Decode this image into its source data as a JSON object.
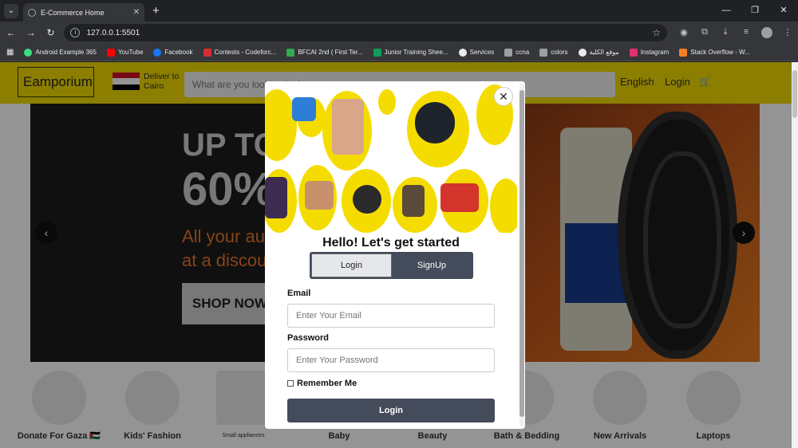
{
  "browser": {
    "tab_title": "E-Commerce Home",
    "url": "127.0.0.1:5501",
    "bookmarks": [
      {
        "label": "Android Example 365",
        "color": "#3ddc84"
      },
      {
        "label": "YouTube",
        "color": "#ff0000"
      },
      {
        "label": "Facebook",
        "color": "#1877f2"
      },
      {
        "label": "Contests - Codeforc...",
        "color": "#d32f2f"
      },
      {
        "label": "BFCAI 2nd ( First Ter...",
        "color": "#34a853"
      },
      {
        "label": "Junior Training Shee...",
        "color": "#0f9d58"
      },
      {
        "label": "Services",
        "color": "#e8eaed"
      },
      {
        "label": "ccna",
        "color": "#9aa0a6"
      },
      {
        "label": "colors",
        "color": "#9aa0a6"
      },
      {
        "label": "موقع الكلية",
        "color": "#e8eaed"
      },
      {
        "label": "Instagram",
        "color": "#e1306c"
      },
      {
        "label": "Stack Overflow - W...",
        "color": "#f48024"
      }
    ]
  },
  "header": {
    "logo": "Eamporium",
    "deliver_line1": "Deliver to",
    "deliver_line2": "Cairo",
    "search_placeholder": "What are you looking for?",
    "language": "English",
    "login": "Login",
    "cart_icon": "🛒"
  },
  "hero": {
    "line1": "UP TO",
    "line2": "60%",
    "line3": "All your autom",
    "line4": "at a discount",
    "cta": "SHOP NOW"
  },
  "categories": [
    {
      "label": "Donate For Gaza 🇵🇸"
    },
    {
      "label": "Kids' Fashion"
    },
    {
      "label": "Small appliances"
    },
    {
      "label": "Baby"
    },
    {
      "label": "Beauty"
    },
    {
      "label": "Bath & Bedding"
    },
    {
      "label": "New Arrivals"
    },
    {
      "label": "Laptops"
    }
  ],
  "modal": {
    "close": "✕",
    "greeting": "Hello! Let's get started",
    "tab_login": "Login",
    "tab_signup": "SignUp",
    "email_label": "Email",
    "email_placeholder": "Enter Your Email",
    "password_label": "Password",
    "password_placeholder": "Enter Your Password",
    "remember": "Remember Me",
    "submit": "Login"
  }
}
